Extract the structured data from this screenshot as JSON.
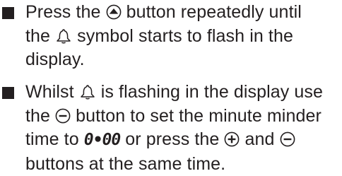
{
  "instructions": [
    {
      "lines": [
        {
          "a": "Press the",
          "b": "button repeatedly until"
        },
        {
          "a": "the",
          "b": "symbol starts to flash in the"
        },
        {
          "a": "display."
        }
      ],
      "icons": [
        "up-button-icon",
        "bell-icon"
      ]
    },
    {
      "lines": [
        {
          "a": "Whilst",
          "b": "is flashing in the display use"
        },
        {
          "a": "the",
          "b": "button to set the minute minder"
        },
        {
          "a": "time to",
          "display": "0•00",
          "b": "or press the",
          "c": "and"
        },
        {
          "a": "buttons at the same time."
        }
      ],
      "icons": [
        "bell-icon",
        "minus-button-icon",
        "plus-button-icon",
        "minus-button-icon"
      ]
    }
  ],
  "colors": {
    "text": "#231f20",
    "bullet": "#231f20"
  }
}
